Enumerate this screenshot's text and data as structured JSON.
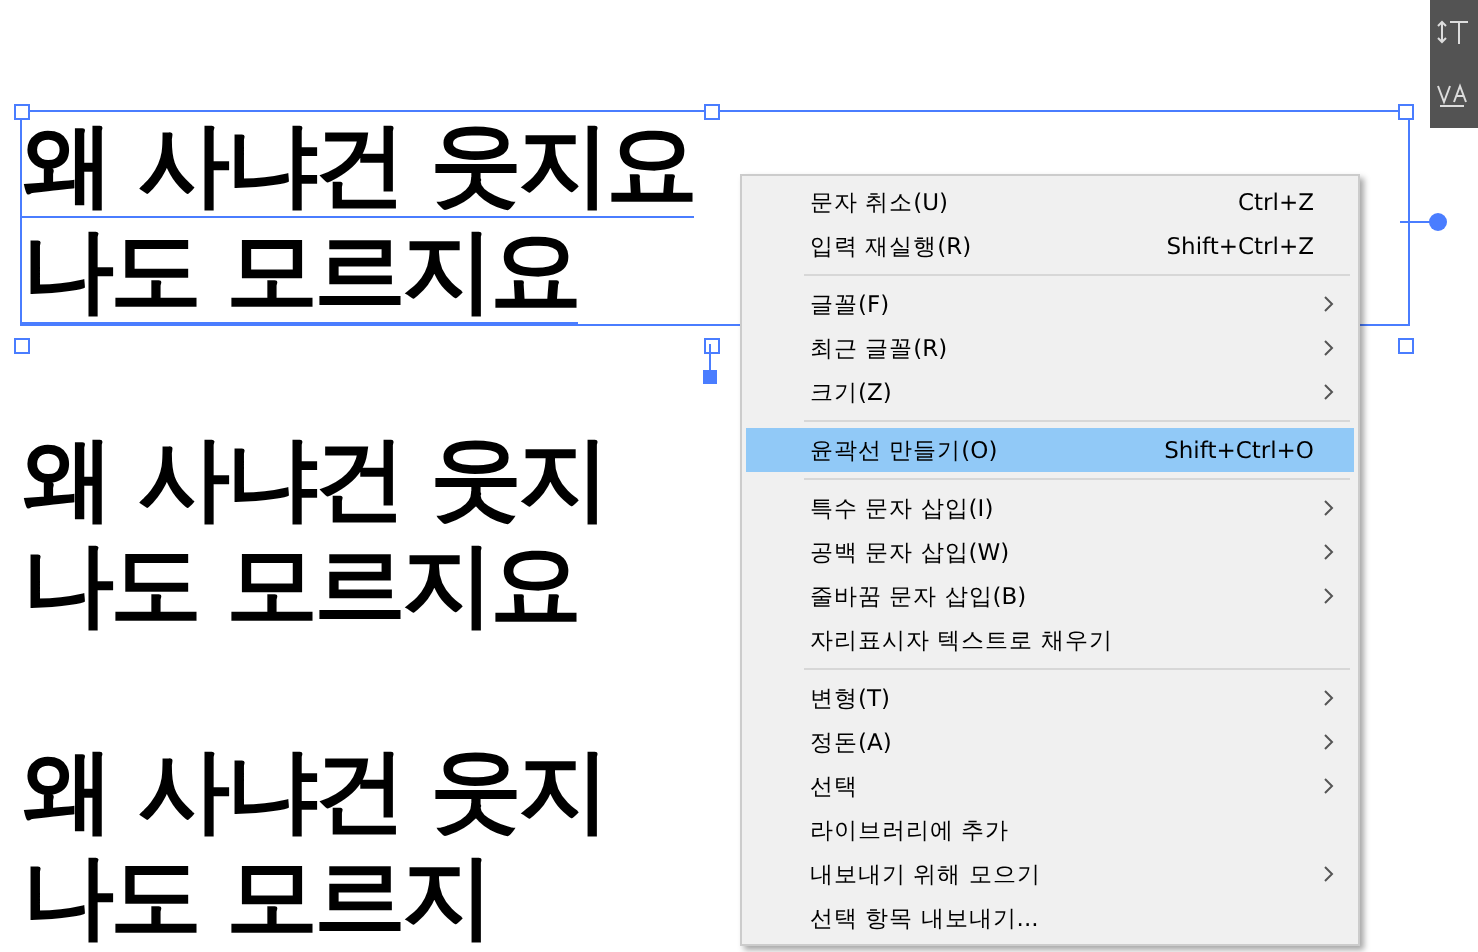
{
  "canvas_texts": [
    {
      "lines": [
        "왜 사냐건 웃지요",
        "나도 모르지요"
      ],
      "selected": true
    },
    {
      "lines": [
        "왜 사냐건 웃지",
        "나도 모르지요"
      ],
      "selected": false
    },
    {
      "lines": [
        "왜 사냐건 웃지",
        "나도 모르지"
      ],
      "selected": false
    }
  ],
  "context_menu": [
    {
      "kind": "item",
      "label": "문자 취소(U)",
      "shortcut": "Ctrl+Z",
      "submenu": false,
      "selected": false
    },
    {
      "kind": "item",
      "label": "입력 재실행(R)",
      "shortcut": "Shift+Ctrl+Z",
      "submenu": false,
      "selected": false
    },
    {
      "kind": "separator"
    },
    {
      "kind": "item",
      "label": "글꼴(F)",
      "submenu": true,
      "selected": false
    },
    {
      "kind": "item",
      "label": "최근 글꼴(R)",
      "submenu": true,
      "selected": false
    },
    {
      "kind": "item",
      "label": "크기(Z)",
      "submenu": true,
      "selected": false
    },
    {
      "kind": "separator"
    },
    {
      "kind": "item",
      "label": "윤곽선 만들기(O)",
      "shortcut": "Shift+Ctrl+O",
      "submenu": false,
      "selected": true
    },
    {
      "kind": "separator"
    },
    {
      "kind": "item",
      "label": "특수 문자 삽입(I)",
      "submenu": true,
      "selected": false
    },
    {
      "kind": "item",
      "label": "공백 문자 삽입(W)",
      "submenu": true,
      "selected": false
    },
    {
      "kind": "item",
      "label": "줄바꿈 문자 삽입(B)",
      "submenu": true,
      "selected": false
    },
    {
      "kind": "item",
      "label": "자리표시자 텍스트로 채우기",
      "submenu": false,
      "selected": false
    },
    {
      "kind": "separator"
    },
    {
      "kind": "item",
      "label": "변형(T)",
      "submenu": true,
      "selected": false
    },
    {
      "kind": "item",
      "label": "정돈(A)",
      "submenu": true,
      "selected": false
    },
    {
      "kind": "item",
      "label": "선택",
      "submenu": true,
      "selected": false
    },
    {
      "kind": "item",
      "label": "라이브러리에 추가",
      "submenu": false,
      "selected": false
    },
    {
      "kind": "item",
      "label": "내보내기 위해 모으기",
      "submenu": true,
      "selected": false
    },
    {
      "kind": "item",
      "label": "선택 항목 내보내기...",
      "submenu": false,
      "selected": false
    }
  ]
}
